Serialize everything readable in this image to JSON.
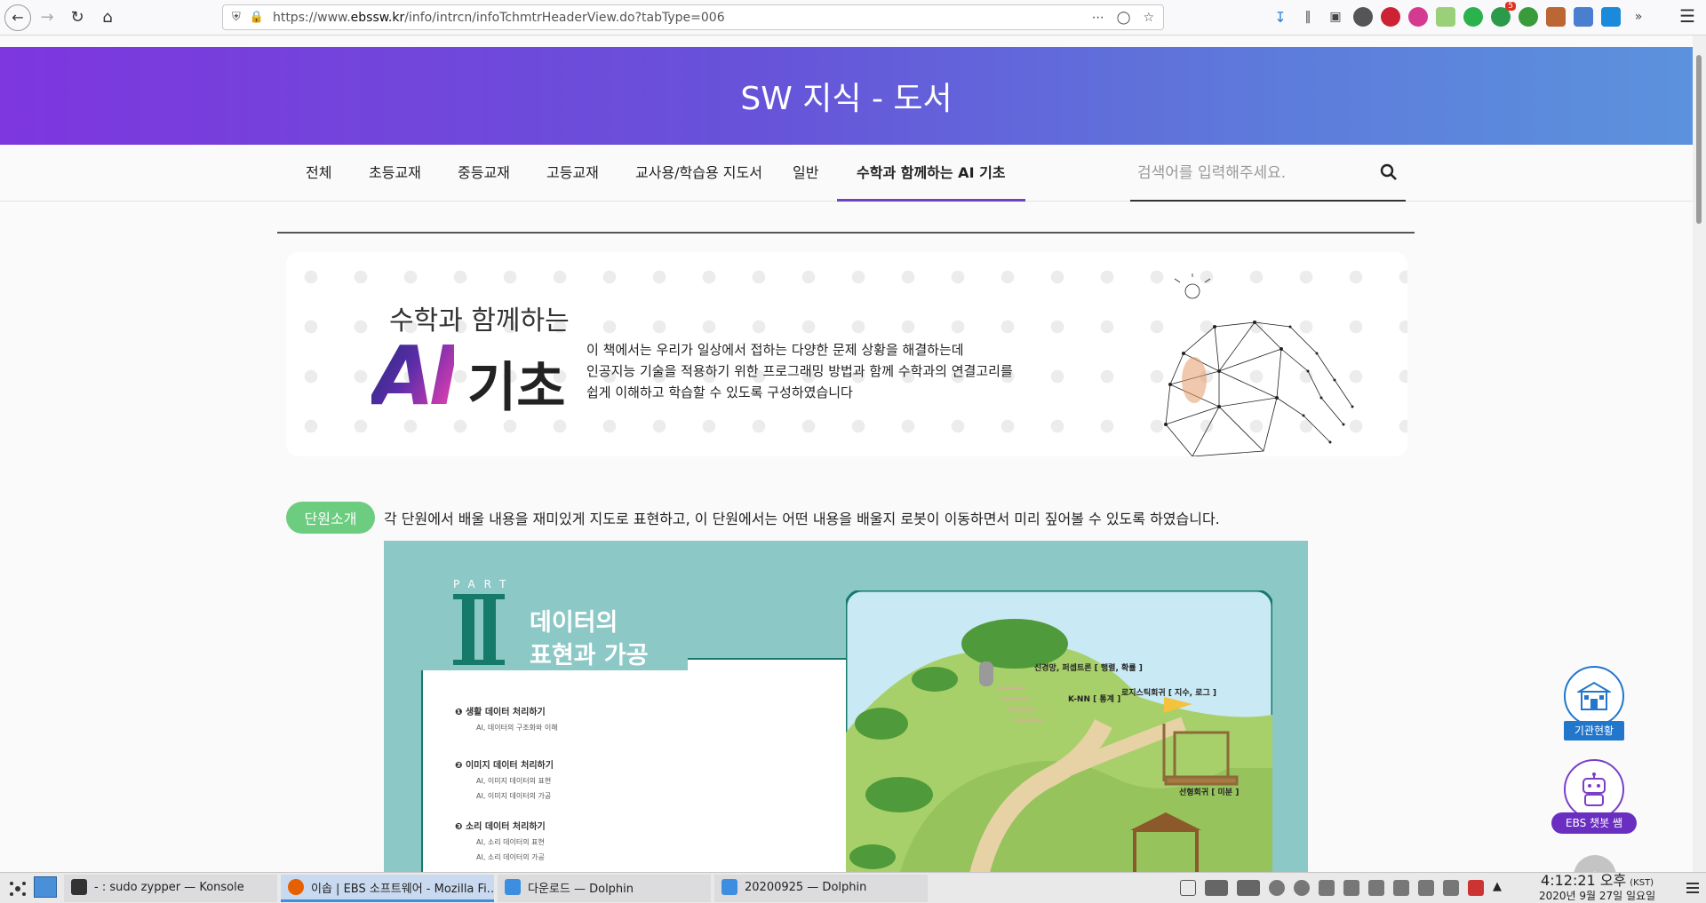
{
  "browser": {
    "url_prefix": "https://www.",
    "url_domain": "ebssw.kr",
    "url_path": "/info/intrcn/infoTchmtrHeaderView.do?tabType=006",
    "ext_badge_count": "5"
  },
  "hero": {
    "title": "SW 지식 - 도서"
  },
  "tabs": [
    {
      "label": "전체"
    },
    {
      "label": "초등교재"
    },
    {
      "label": "중등교재"
    },
    {
      "label": "고등교재"
    },
    {
      "label": "교사용/학습용 지도서"
    },
    {
      "label": "일반"
    },
    {
      "label": "수학과 함께하는 AI 기초"
    }
  ],
  "search": {
    "placeholder": "검색어를 입력해주세요."
  },
  "banner": {
    "subtitle": "수학과 함께하는",
    "title_ai": "AI",
    "title_rest": "기초",
    "desc_lines": [
      "이 책에서는 우리가 일상에서 접하는 다양한 문제 상황을 해결하는데",
      "인공지능 기술을 적용하기 위한 프로그래밍 방법과 함께 수학과의 연결고리를",
      "쉽게 이해하고 학습할 수 있도록 구성하였습니다"
    ]
  },
  "unit": {
    "badge": "단원소개",
    "text": "각 단원에서 배울 내용을 재미있게 지도로 표현하고, 이 단원에서는 어떤 내용을 배울지 로봇이 이동하면서 미리 짚어볼 수 있도록 하였습니다."
  },
  "map": {
    "part_label": "PART",
    "part_title_1": "데이터의",
    "part_title_2": "표현과 가공",
    "sections": [
      {
        "title": "생활 데이터 처리하기",
        "subs": [
          "AI, 데이터의 구조화와 이해"
        ]
      },
      {
        "title": "이미지 데이터 처리하기",
        "subs": [
          "AI, 이미지 데이터의 표현",
          "AI, 이미지 데이터의 가공"
        ]
      },
      {
        "title": "소리 데이터 처리하기",
        "subs": [
          "AI, 소리 데이터의 표현",
          "AI, 소리 데이터의 가공"
        ]
      }
    ],
    "landmarks": [
      "신경망, 퍼셉트론 [ 행렬, 확률 ]",
      "K-NN [ 통계 ]",
      "로지스틱회귀 [ 지수, 로그 ]",
      "선형회귀 [ 미분 ]"
    ]
  },
  "floats": {
    "org_label": "기관현황",
    "bot_label": "EBS 챗봇 쌤"
  },
  "taskbar": {
    "tasks": [
      "- : sudo zypper — Konsole",
      "이솝 | EBS 소프트웨어 - Mozilla Fi…",
      "다운로드 — Dolphin",
      "20200925 — Dolphin"
    ],
    "time": "4:12:21 오후",
    "tz": "(KST)",
    "date": "2020년 9월 27일 일요일"
  }
}
